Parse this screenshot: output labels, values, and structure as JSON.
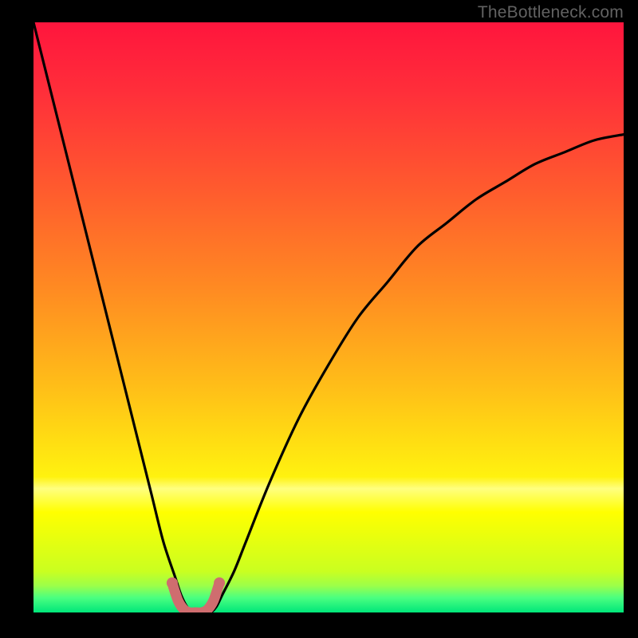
{
  "watermark": "TheBottleneck.com",
  "colors": {
    "background": "#000000",
    "curve": "#000000",
    "marker": "#cf6d6f",
    "gradient_stops": [
      {
        "offset": 0.0,
        "color": "#ff153d"
      },
      {
        "offset": 0.12,
        "color": "#ff2f3a"
      },
      {
        "offset": 0.28,
        "color": "#ff5a2e"
      },
      {
        "offset": 0.45,
        "color": "#ff8a22"
      },
      {
        "offset": 0.62,
        "color": "#ffbf18"
      },
      {
        "offset": 0.77,
        "color": "#fff20f"
      },
      {
        "offset": 0.79,
        "color": "#ffff80"
      },
      {
        "offset": 0.83,
        "color": "#ffff00"
      },
      {
        "offset": 0.93,
        "color": "#caff20"
      },
      {
        "offset": 0.955,
        "color": "#9bff4a"
      },
      {
        "offset": 0.975,
        "color": "#4bff80"
      },
      {
        "offset": 1.0,
        "color": "#00e67a"
      }
    ]
  },
  "chart_data": {
    "type": "line",
    "title": "",
    "xlabel": "",
    "ylabel": "",
    "xlim": [
      0,
      100
    ],
    "ylim": [
      0,
      100
    ],
    "x": [
      0,
      5,
      10,
      15,
      18,
      20,
      22,
      24,
      25,
      26,
      27,
      28,
      29,
      30,
      31,
      32,
      34,
      36,
      40,
      45,
      50,
      55,
      60,
      65,
      70,
      75,
      80,
      85,
      90,
      95,
      100
    ],
    "values": [
      100,
      80,
      60,
      40,
      28,
      20,
      12,
      6,
      3,
      1,
      0,
      0,
      0,
      0,
      1,
      3,
      7,
      12,
      22,
      33,
      42,
      50,
      56,
      62,
      66,
      70,
      73,
      76,
      78,
      80,
      81
    ],
    "markers": {
      "x": [
        23.5,
        24.5,
        25.5,
        26.5,
        27.5,
        28.5,
        29.5,
        30.5,
        31.5
      ],
      "y": [
        5,
        2,
        0.5,
        0,
        0,
        0,
        0.5,
        2,
        5
      ]
    }
  }
}
